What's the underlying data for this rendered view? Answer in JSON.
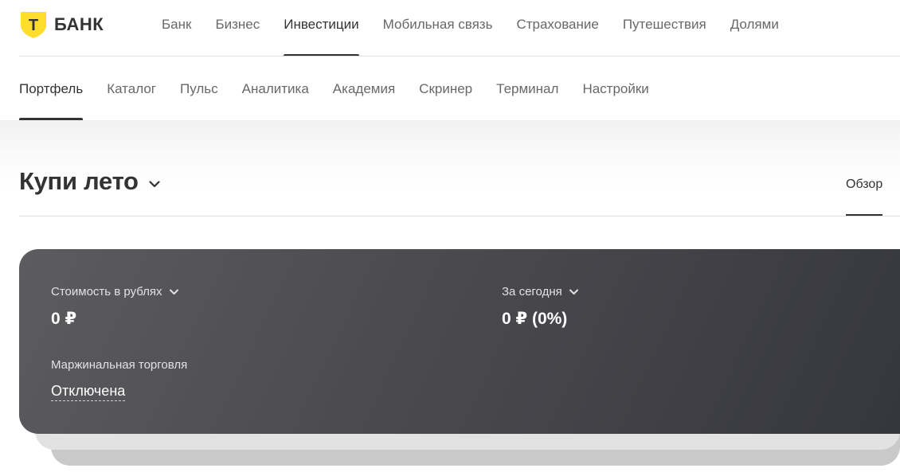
{
  "brand": {
    "logo_text": "БАНК",
    "logo_glyph": "Т",
    "accent_color": "#ffdd2d"
  },
  "top_nav": {
    "items": [
      {
        "label": "Банк",
        "active": false
      },
      {
        "label": "Бизнес",
        "active": false
      },
      {
        "label": "Инвестиции",
        "active": true
      },
      {
        "label": "Мобильная связь",
        "active": false
      },
      {
        "label": "Страхование",
        "active": false
      },
      {
        "label": "Путешествия",
        "active": false
      },
      {
        "label": "Долями",
        "active": false
      }
    ]
  },
  "sub_nav": {
    "items": [
      {
        "label": "Портфель",
        "active": true
      },
      {
        "label": "Каталог",
        "active": false
      },
      {
        "label": "Пульс",
        "active": false
      },
      {
        "label": "Аналитика",
        "active": false
      },
      {
        "label": "Академия",
        "active": false
      },
      {
        "label": "Скринер",
        "active": false
      },
      {
        "label": "Терминал",
        "active": false
      },
      {
        "label": "Настройки",
        "active": false
      }
    ]
  },
  "portfolio": {
    "title": "Купи лето",
    "title_icon": "chevron-down-icon",
    "tab_overview": "Обзор"
  },
  "summary_card": {
    "value_label": "Стоимость в рублях",
    "value": "0 ₽",
    "today_label": "За сегодня",
    "today_value": "0 ₽ (0%)",
    "margin_label": "Маржинальная торговля",
    "margin_status": "Отключена",
    "card_color_start": "#5c5c5f",
    "card_color_end": "#35353d"
  }
}
